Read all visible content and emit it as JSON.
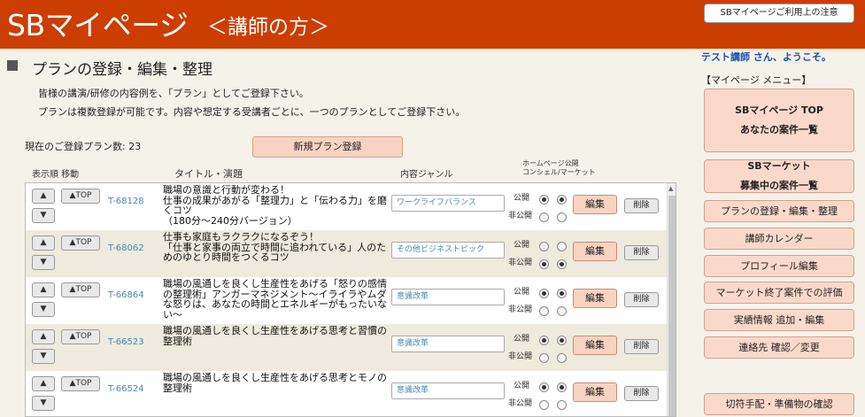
{
  "header": {
    "brand": "SBマイページ",
    "subtitle": "＜講師の方＞",
    "notice_button": "SBマイページご利用上の注意"
  },
  "main": {
    "title": "プランの登録・編集・整理",
    "desc1": "皆様の講演/研修の内容例を、「プラン」としてご登録下さい。",
    "desc2": "プランは複数登録が可能です。内容や想定する受講者ごとに、一つのプランとしてご登録下さい。",
    "count_label": "現在のご登録プラン数:  23",
    "new_plan_button": "新規プラン登録",
    "col_order": "表示順 移動",
    "col_title": "タイトル・演題",
    "col_genre": "内容ジャンル",
    "col_public_1": "ホームページ公開",
    "col_public_2": "コンシェル/マーケット"
  },
  "row_labels": {
    "up": "▲",
    "down": "▼",
    "top": "▲TOP",
    "public": "公開",
    "private": "非公開",
    "edit": "編集",
    "delete": "削除"
  },
  "rows": [
    {
      "id": "T-68128",
      "title": "職場の意識と行動が変わる！\n仕事の成果があがる「整理力」と「伝わる力」を磨くコツ\n（180分〜240分バージョン）",
      "genre": "ワークライフバランス",
      "hp_public": true,
      "mk_public": true
    },
    {
      "id": "T-68062",
      "title": "仕事も家庭もラクラクになるぞう！\n「仕事と家事の両立で時間に追われている」人のためのゆとり時間をつくるコツ",
      "genre": "その他ビジネストピック",
      "hp_public": false,
      "mk_public": false
    },
    {
      "id": "T-66864",
      "title": "職場の風通しを良くし生産性をあげる「怒りの感情の整理術」アンガーマネジメント〜イライラやムダな怒りは、あなたの時間とエネルギーがもったいない〜",
      "genre": "意識改革",
      "hp_public": true,
      "mk_public": true
    },
    {
      "id": "T-66523",
      "title": "職場の風通しを良くし生産性をあげる思考と習慣の整理術",
      "genre": "意識改革",
      "hp_public": true,
      "mk_public": true
    },
    {
      "id": "T-66524",
      "title": "職場の風通しを良くし生産性をあげる思考とモノの整理術",
      "genre": "意識改革",
      "hp_public": true,
      "mk_public": true
    }
  ],
  "sidebar": {
    "welcome": "テスト講師 さん、ようこそ。",
    "menu_head": "【マイページ メニュー】",
    "items": [
      {
        "label": "SBマイページ TOP\nあなたの案件一覧"
      },
      {
        "label": "SBマーケット\n募集中の案件一覧"
      },
      {
        "label": "プランの登録・編集・整理"
      },
      {
        "label": "講師カレンダー"
      },
      {
        "label": "プロフィール編集"
      },
      {
        "label": "マーケット終了案件での評価"
      },
      {
        "label": "実績情報 追加・編集"
      },
      {
        "label": "連絡先 確認／変更"
      },
      {
        "label": "切符手配・準備物の確認"
      }
    ]
  },
  "colors": {
    "header_bg": "#cc3d00",
    "accent_button": "#fbd9ca",
    "id_link": "#4a88b5",
    "welcome_text": "#1a4fb0"
  }
}
